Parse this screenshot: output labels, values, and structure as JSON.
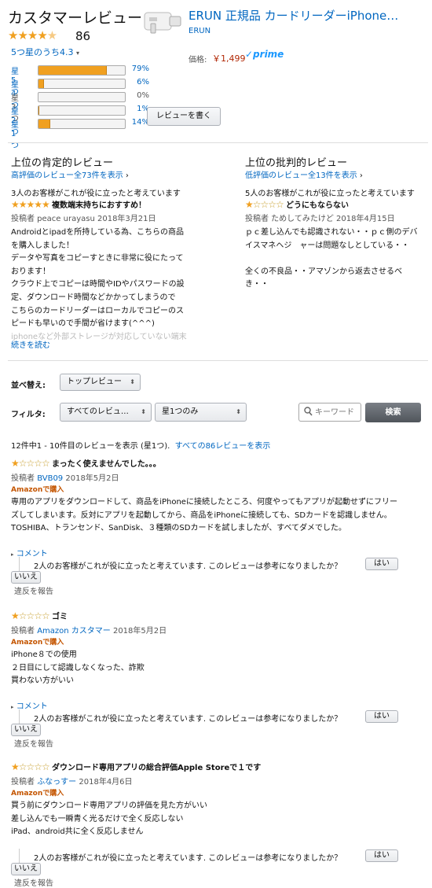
{
  "header": {
    "title": "カスタマーレビュー",
    "rating_count": "86",
    "average": "5つ星のうち4.3"
  },
  "histogram": [
    {
      "label": "星5つ",
      "pct": "79%",
      "value": 79
    },
    {
      "label": "星4つ",
      "pct": "6%",
      "value": 6
    },
    {
      "label": "星3つ",
      "pct": "0%",
      "value": 0
    },
    {
      "label": "星2つ",
      "pct": "1%",
      "value": 1
    },
    {
      "label": "星1つ",
      "pct": "14%",
      "value": 14
    }
  ],
  "write_review": "レビューを書く",
  "product": {
    "title": "ERUN 正規品 カードリーダーiPhone…",
    "brand": "ERUN",
    "price_label": "価格:",
    "price": "￥1,499",
    "prime": "✓prime"
  },
  "positive": {
    "heading": "上位の肯定的レビュー",
    "link": "高評価のレビュー全73件を表示",
    "helpful": "3人のお客様がこれが役に立ったと考えています",
    "stars": 5,
    "title": "複数端末持ちにおすすめ！",
    "byline": "投稿者 peace urayasu 2018年3月21日",
    "lines": [
      "Androidとipadを所持している為、こちらの商品",
      "を購入しました！",
      "データや写真をコピーすときに非常に役にたって",
      "おります！",
      "クラウド上でコピーは時間やIDやパスワードの設",
      "定、ダウンロード時間などかかってしまうので",
      "こちらのカードリーダーはローカルでコピーのス",
      "ピードも早いので手間が省けます(^^^)"
    ],
    "fade_line": "iphoneなど外部ストレージが対応していない端末",
    "read_more": "続きを読む"
  },
  "critical": {
    "heading": "上位の批判的レビュー",
    "link": "低評価のレビュー全13件を表示",
    "helpful": "5人のお客様がこれが役に立ったと考えています",
    "stars": 1,
    "title": "どうにもならない",
    "byline": "投稿者 ためしてみたけど 2018年4月15日",
    "lines": [
      "ｐｃ差し込んでも認識されない・・ｐｃ側のデバ",
      "イスマネヘジ　ャーは問題なしとしている・・",
      "",
      "全くの不良品・・アマゾンから返去させるべ",
      "き・・"
    ]
  },
  "controls": {
    "sort_label": "並べ替え:",
    "sort_value": "トップレビュー",
    "filter_label": "フィルタ:",
    "filter_reviewers": "すべてのレビュ…",
    "filter_stars": "星1つのみ",
    "search_placeholder": "キーワード",
    "search_button": "検索"
  },
  "summary": {
    "text": "12件中1 - 10件目のレビューを表示 (星1つ).",
    "link": "すべての86レビューを表示"
  },
  "reviews": [
    {
      "title": "まったく使えませんでした。。。",
      "by": "投稿者 ",
      "author": "BVB09",
      "date": " 2018年5月2日",
      "verified": "Amazonで購入",
      "lines": [
        "専用のアプリをダウンロードして、商品をiPhoneに接続したところ、何度やってもアプリが起動せずにフリー",
        "ズしてしまいます。反対にアプリを起動してから、商品をiPhoneに接続しても、SDカードを認識しません。",
        "TOSHIBA、トランセンド、SanDisk、３種類のSDカードを試しましたが、すべてダメでした。"
      ],
      "comment": "コメント",
      "helpful": "2人のお客様がこれが役に立ったと考えています. このレビューは参考になりましたか？",
      "yes": "はい",
      "no": "いいえ",
      "report": "違反を報告"
    },
    {
      "title": "ゴミ",
      "by": "投稿者 ",
      "author": "Amazon カスタマー",
      "date": " 2018年5月2日",
      "verified": "Amazonで購入",
      "lines": [
        "iPhone８での使用",
        "２日目にして認識しなくなった、詐欺",
        "買わない方がいい"
      ],
      "comment": "コメント",
      "helpful": "2人のお客様がこれが役に立ったと考えています. このレビューは参考になりましたか？",
      "yes": "はい",
      "no": "いいえ",
      "report": "違反を報告"
    },
    {
      "title": "ダウンロード専用アプリの総合評価Apple Storeで１です",
      "by": "投稿者 ",
      "author": "ふなっすー",
      "date": " 2018年4月6日",
      "verified": "Amazonで購入",
      "lines": [
        "買う前にダウンロード専用アプリの評価を見た方がいい",
        "差し込んでも一瞬青く光るだけで全く反応しない",
        "iPad、android共に全く反応しません"
      ],
      "helpful": "2人のお客様がこれが役に立ったと考えています. このレビューは参考になりましたか？",
      "yes": "はい",
      "no": "いいえ",
      "report": "違反を報告"
    }
  ]
}
